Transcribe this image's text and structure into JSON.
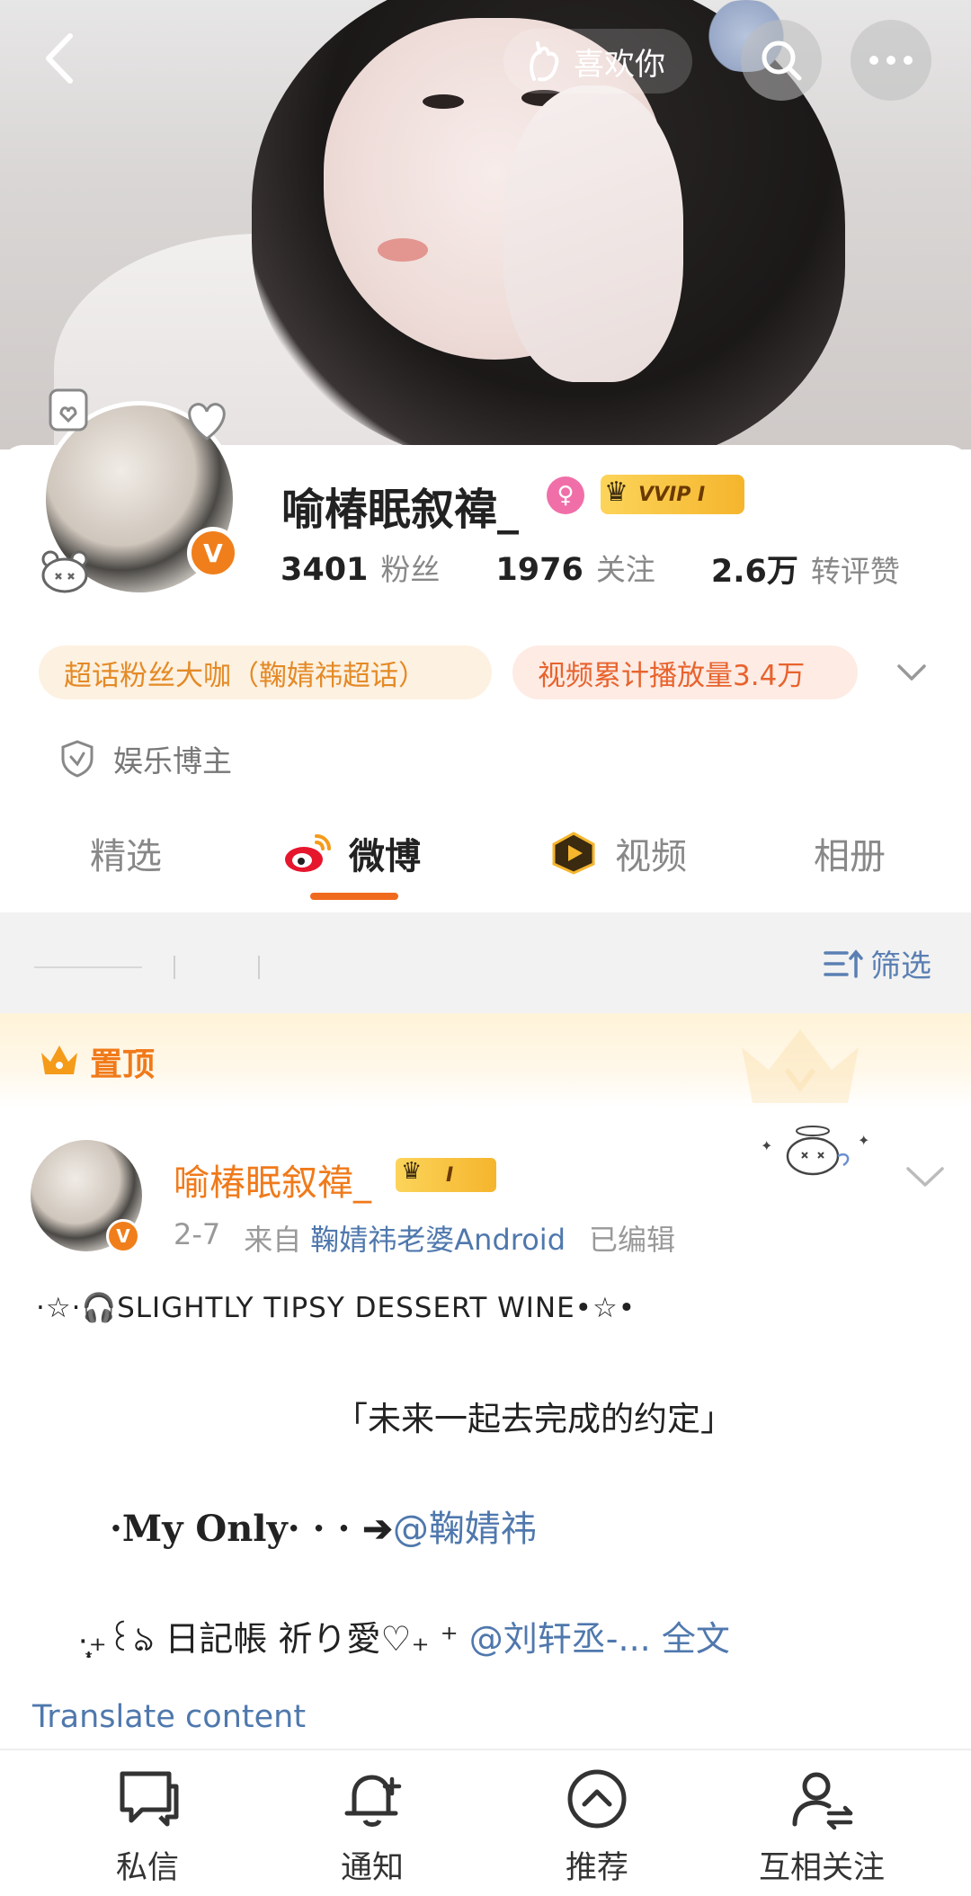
{
  "header": {
    "like_label": "喜欢你"
  },
  "profile": {
    "name": "喻椿眠叙禕_",
    "vip_badge": "VVIP I",
    "stats": [
      {
        "value": "3401",
        "label": "粉丝"
      },
      {
        "value": "1976",
        "label": "关注"
      },
      {
        "value": "2.6万",
        "label": "转评赞"
      }
    ],
    "tags": [
      "超话粉丝大咖（鞠婧祎超话）",
      "视频累计播放量3.4万"
    ],
    "certification": "娱乐博主"
  },
  "tabs": [
    {
      "label": "精选",
      "active": false
    },
    {
      "label": "微博",
      "active": true
    },
    {
      "label": "视频",
      "active": false
    },
    {
      "label": "相册",
      "active": false
    }
  ],
  "filter": {
    "label": "筛选"
  },
  "pinned": {
    "label": "置顶"
  },
  "post": {
    "author": "喻椿眠叙禕_",
    "badge": "I",
    "date": "2-7",
    "from_prefix": "来自",
    "source": "鞠婧祎老婆Android",
    "edited": "已编辑",
    "line1": "·☆·🎧SLIGHTLY TIPSY DESSERT WINE•☆•",
    "line2": "「未来一起去完成的约定」",
    "line3_prefix": "·My Only· · · ➔",
    "line3_mention": "@鞠婧祎",
    "line4_text": "·̩͙₊꒰ঌ 日記帳 祈り愛♡₊ ⁺ ",
    "line4_mention": "@刘轩丞-...",
    "full_text": "全文",
    "translate": "Translate content"
  },
  "bottom_nav": [
    {
      "label": "私信",
      "icon": "message-icon"
    },
    {
      "label": "通知",
      "icon": "bell-icon"
    },
    {
      "label": "推荐",
      "icon": "up-arrow-circle-icon"
    },
    {
      "label": "互相关注",
      "icon": "mutual-follow-icon"
    }
  ],
  "colors": {
    "accent": "#f07a1a",
    "link": "#4f78ad",
    "tag1_bg": "#fdf1e1",
    "tag2_bg": "#fdebe4"
  }
}
